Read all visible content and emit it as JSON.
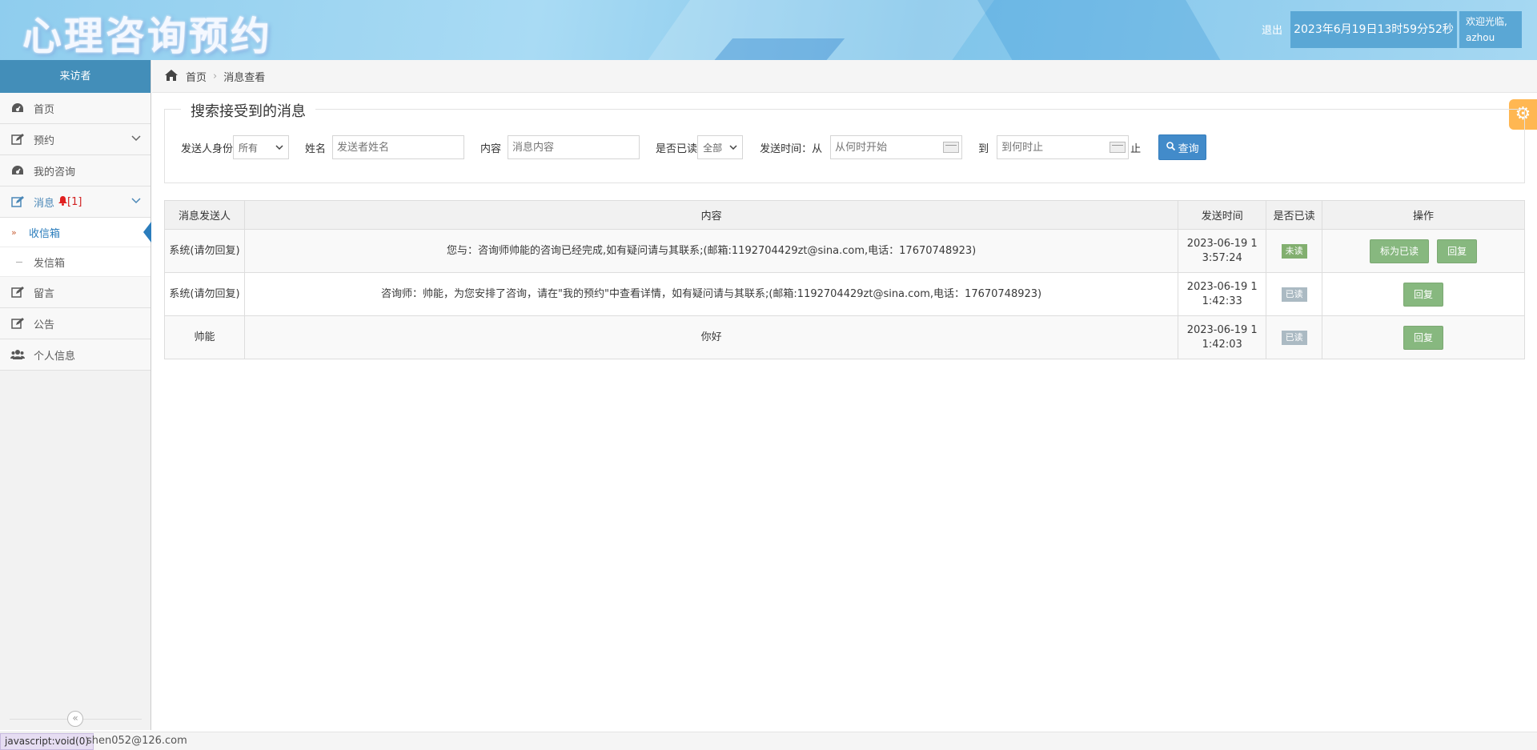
{
  "header": {
    "logo": "心理咨询预约",
    "logout": "退出",
    "datetime": "2023年6月19日13时59分52秒",
    "welcome_line1": "欢迎光临,",
    "welcome_line2": "azhou"
  },
  "sidebar": {
    "title": "来访者",
    "items": {
      "home": "首页",
      "appointment": "预约",
      "my_consult": "我的咨询",
      "messages": "消息",
      "messages_count": "[1]",
      "inbox": "收信箱",
      "outbox": "发信箱",
      "guestbook": "留言",
      "notice": "公告",
      "profile": "个人信息"
    },
    "collapse_icon": "double-chevron-left"
  },
  "breadcrumb": {
    "home": "首页",
    "current": "消息查看"
  },
  "search": {
    "legend": "搜索接受到的消息",
    "sender_identity_label": "发送人身份",
    "sender_identity_value": "所有",
    "name_label": "姓名",
    "name_placeholder": "发送者姓名",
    "content_label": "内容",
    "content_placeholder": "消息内容",
    "read_label": "是否已读",
    "read_value": "全部",
    "time_label": "发送时间：从",
    "from_placeholder": "从何时开始",
    "to_label": "到",
    "to_placeholder": "到何时止",
    "to_suffix": "止",
    "query_button": "查询"
  },
  "table": {
    "headers": {
      "sender": "消息发送人",
      "content": "内容",
      "time": "发送时间",
      "read": "是否已读",
      "actions": "操作"
    },
    "rows": [
      {
        "sender": "系统(请勿回复)",
        "content": "您与：咨询师帅能的咨询已经完成,如有疑问请与其联系;(邮箱:1192704429zt@sina.com,电话：17670748923)",
        "time_line1": "2023-06-19 1",
        "time_line2": "3:57:24",
        "status": "未读",
        "mark_read": "标为已读",
        "reply": "回复"
      },
      {
        "sender": "系统(请勿回复)",
        "content": "咨询师：帅能，为您安排了咨询，请在\"我的预约\"中查看详情，如有疑问请与其联系;(邮箱:1192704429zt@sina.com,电话：17670748923)",
        "time_line1": "2023-06-19 1",
        "time_line2": "1:42:33",
        "status": "已读",
        "reply": "回复"
      },
      {
        "sender": "帅能",
        "content": "你好",
        "time_line1": "2023-06-19 1",
        "time_line2": "1:42:03",
        "status": "已读",
        "reply": "回复"
      }
    ]
  },
  "statusbar": {
    "link": "javascript:void(0)",
    "email": "shen052@126.com"
  },
  "colors": {
    "sidebar_head": "#438eb9",
    "unread_badge": "#82af6f",
    "read_badge": "#abbac3",
    "action_button": "#87b87f",
    "query_button": "#428bca",
    "settings_button": "#ffb752"
  }
}
